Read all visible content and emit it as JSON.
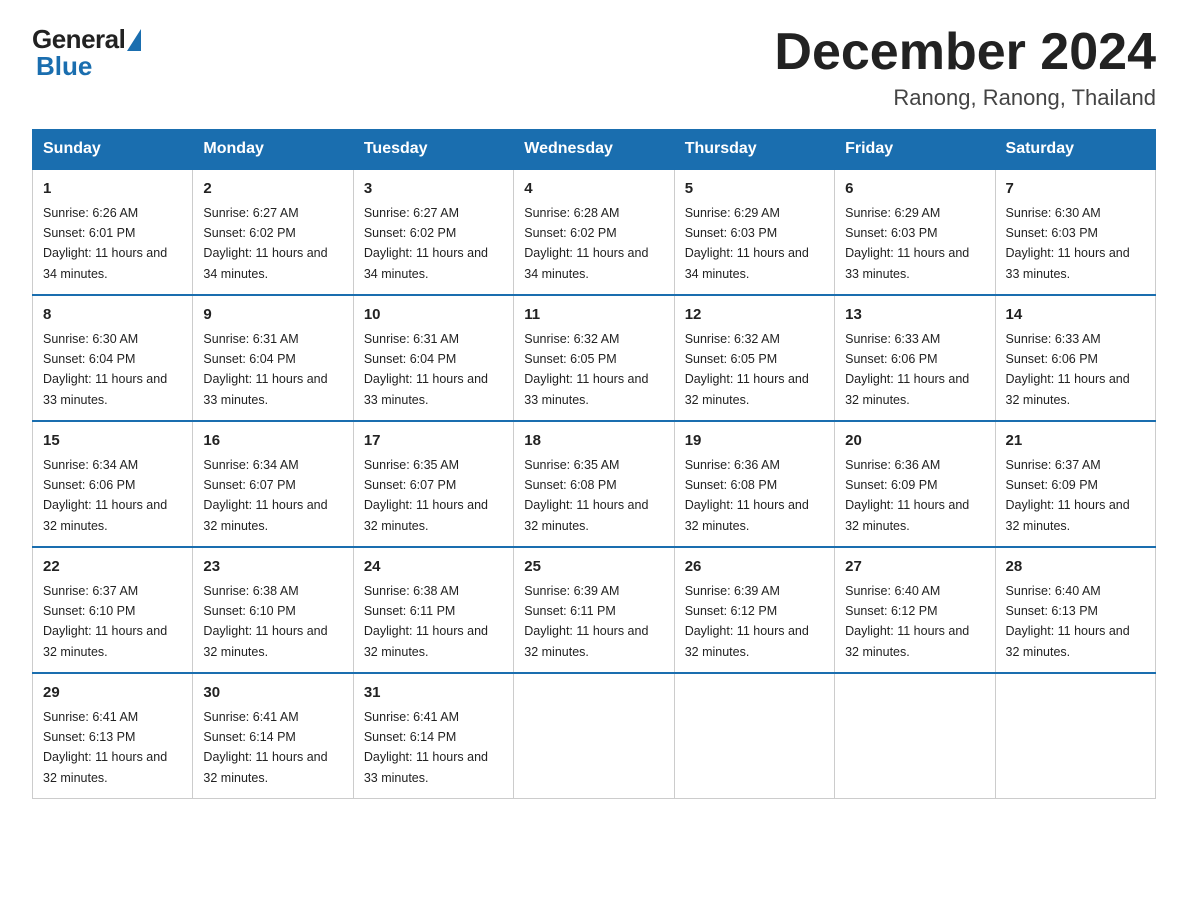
{
  "logo": {
    "general": "General",
    "blue": "Blue"
  },
  "title": "December 2024",
  "location": "Ranong, Ranong, Thailand",
  "days_header": [
    "Sunday",
    "Monday",
    "Tuesday",
    "Wednesday",
    "Thursday",
    "Friday",
    "Saturday"
  ],
  "weeks": [
    [
      {
        "day": "1",
        "sunrise": "6:26 AM",
        "sunset": "6:01 PM",
        "daylight": "11 hours and 34 minutes."
      },
      {
        "day": "2",
        "sunrise": "6:27 AM",
        "sunset": "6:02 PM",
        "daylight": "11 hours and 34 minutes."
      },
      {
        "day": "3",
        "sunrise": "6:27 AM",
        "sunset": "6:02 PM",
        "daylight": "11 hours and 34 minutes."
      },
      {
        "day": "4",
        "sunrise": "6:28 AM",
        "sunset": "6:02 PM",
        "daylight": "11 hours and 34 minutes."
      },
      {
        "day": "5",
        "sunrise": "6:29 AM",
        "sunset": "6:03 PM",
        "daylight": "11 hours and 34 minutes."
      },
      {
        "day": "6",
        "sunrise": "6:29 AM",
        "sunset": "6:03 PM",
        "daylight": "11 hours and 33 minutes."
      },
      {
        "day": "7",
        "sunrise": "6:30 AM",
        "sunset": "6:03 PM",
        "daylight": "11 hours and 33 minutes."
      }
    ],
    [
      {
        "day": "8",
        "sunrise": "6:30 AM",
        "sunset": "6:04 PM",
        "daylight": "11 hours and 33 minutes."
      },
      {
        "day": "9",
        "sunrise": "6:31 AM",
        "sunset": "6:04 PM",
        "daylight": "11 hours and 33 minutes."
      },
      {
        "day": "10",
        "sunrise": "6:31 AM",
        "sunset": "6:04 PM",
        "daylight": "11 hours and 33 minutes."
      },
      {
        "day": "11",
        "sunrise": "6:32 AM",
        "sunset": "6:05 PM",
        "daylight": "11 hours and 33 minutes."
      },
      {
        "day": "12",
        "sunrise": "6:32 AM",
        "sunset": "6:05 PM",
        "daylight": "11 hours and 32 minutes."
      },
      {
        "day": "13",
        "sunrise": "6:33 AM",
        "sunset": "6:06 PM",
        "daylight": "11 hours and 32 minutes."
      },
      {
        "day": "14",
        "sunrise": "6:33 AM",
        "sunset": "6:06 PM",
        "daylight": "11 hours and 32 minutes."
      }
    ],
    [
      {
        "day": "15",
        "sunrise": "6:34 AM",
        "sunset": "6:06 PM",
        "daylight": "11 hours and 32 minutes."
      },
      {
        "day": "16",
        "sunrise": "6:34 AM",
        "sunset": "6:07 PM",
        "daylight": "11 hours and 32 minutes."
      },
      {
        "day": "17",
        "sunrise": "6:35 AM",
        "sunset": "6:07 PM",
        "daylight": "11 hours and 32 minutes."
      },
      {
        "day": "18",
        "sunrise": "6:35 AM",
        "sunset": "6:08 PM",
        "daylight": "11 hours and 32 minutes."
      },
      {
        "day": "19",
        "sunrise": "6:36 AM",
        "sunset": "6:08 PM",
        "daylight": "11 hours and 32 minutes."
      },
      {
        "day": "20",
        "sunrise": "6:36 AM",
        "sunset": "6:09 PM",
        "daylight": "11 hours and 32 minutes."
      },
      {
        "day": "21",
        "sunrise": "6:37 AM",
        "sunset": "6:09 PM",
        "daylight": "11 hours and 32 minutes."
      }
    ],
    [
      {
        "day": "22",
        "sunrise": "6:37 AM",
        "sunset": "6:10 PM",
        "daylight": "11 hours and 32 minutes."
      },
      {
        "day": "23",
        "sunrise": "6:38 AM",
        "sunset": "6:10 PM",
        "daylight": "11 hours and 32 minutes."
      },
      {
        "day": "24",
        "sunrise": "6:38 AM",
        "sunset": "6:11 PM",
        "daylight": "11 hours and 32 minutes."
      },
      {
        "day": "25",
        "sunrise": "6:39 AM",
        "sunset": "6:11 PM",
        "daylight": "11 hours and 32 minutes."
      },
      {
        "day": "26",
        "sunrise": "6:39 AM",
        "sunset": "6:12 PM",
        "daylight": "11 hours and 32 minutes."
      },
      {
        "day": "27",
        "sunrise": "6:40 AM",
        "sunset": "6:12 PM",
        "daylight": "11 hours and 32 minutes."
      },
      {
        "day": "28",
        "sunrise": "6:40 AM",
        "sunset": "6:13 PM",
        "daylight": "11 hours and 32 minutes."
      }
    ],
    [
      {
        "day": "29",
        "sunrise": "6:41 AM",
        "sunset": "6:13 PM",
        "daylight": "11 hours and 32 minutes."
      },
      {
        "day": "30",
        "sunrise": "6:41 AM",
        "sunset": "6:14 PM",
        "daylight": "11 hours and 32 minutes."
      },
      {
        "day": "31",
        "sunrise": "6:41 AM",
        "sunset": "6:14 PM",
        "daylight": "11 hours and 33 minutes."
      },
      null,
      null,
      null,
      null
    ]
  ]
}
